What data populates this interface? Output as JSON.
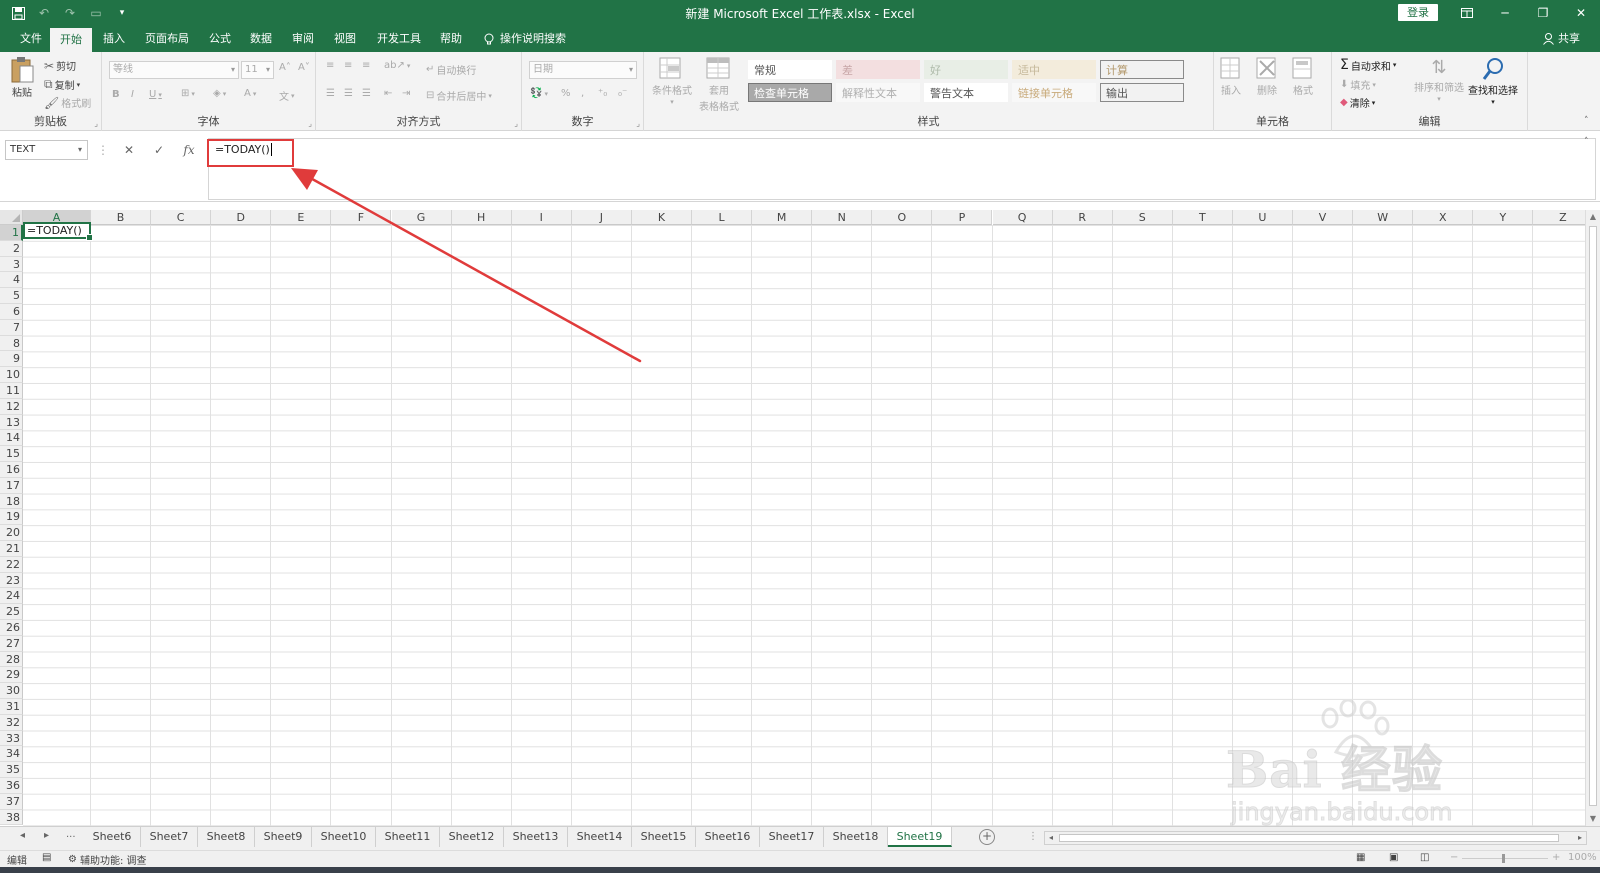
{
  "window": {
    "title": "新建 Microsoft Excel 工作表.xlsx  -  Excel",
    "login_label": "登录",
    "controls": [
      "ribbon-display-icon",
      "minimize-icon",
      "restore-icon",
      "close-icon"
    ]
  },
  "menu": {
    "tabs": [
      {
        "label": "文件"
      },
      {
        "label": "开始",
        "active": true
      },
      {
        "label": "插入"
      },
      {
        "label": "页面布局"
      },
      {
        "label": "公式"
      },
      {
        "label": "数据"
      },
      {
        "label": "审阅"
      },
      {
        "label": "视图"
      },
      {
        "label": "开发工具"
      },
      {
        "label": "帮助"
      }
    ],
    "tell_me": "操作说明搜索",
    "share": "共享"
  },
  "ribbon": {
    "clipboard": {
      "label": "剪贴板",
      "paste": "粘贴",
      "cut": "剪切",
      "copy": "复制",
      "format_painter": "格式刷"
    },
    "font": {
      "label": "字体",
      "font_name": "等线",
      "font_size": "11"
    },
    "alignment": {
      "label": "对齐方式",
      "wrap_text": "自动换行",
      "merge_center": "合并后居中"
    },
    "number": {
      "label": "数字",
      "format": "日期"
    },
    "styles": {
      "label": "样式",
      "conditional_formatting": "条件格式",
      "format_as_table_line1": "套用",
      "format_as_table_line2": "表格格式",
      "cells": [
        {
          "label": "常规",
          "bg": "#ffffff",
          "fg": "#555555"
        },
        {
          "label": "差",
          "bg": "#f3dfe0",
          "fg": "#c8a7a8"
        },
        {
          "label": "好",
          "bg": "#e8eee6",
          "fg": "#aebaa9"
        },
        {
          "label": "适中",
          "bg": "#f3ecdc",
          "fg": "#c6b99b"
        },
        {
          "label": "计算",
          "bg": "#f2f2f2",
          "fg": "#b49a6e"
        },
        {
          "label": "检查单元格",
          "bg": "#a9a9a9",
          "fg": "#ffffff"
        },
        {
          "label": "解释性文本",
          "bg": "#f8f8f8",
          "fg": "#b0b0b0"
        },
        {
          "label": "警告文本",
          "bg": "#ffffff",
          "fg": "#555555"
        },
        {
          "label": "链接单元格",
          "bg": "#f8f8f8",
          "fg": "#c8aa7a"
        },
        {
          "label": "输出",
          "bg": "#f2f2f2",
          "fg": "#555555"
        }
      ]
    },
    "cells": {
      "label": "单元格",
      "insert": "插入",
      "delete": "删除",
      "format": "格式"
    },
    "editing": {
      "label": "编辑",
      "autosum": "自动求和",
      "fill": "填充",
      "clear": "清除",
      "sort_filter": "排序和筛选",
      "find_select": "查找和选择"
    }
  },
  "formula_bar": {
    "name_box": "TEXT",
    "cancel_icon": "close-icon",
    "enter_icon": "check-icon",
    "fx_label": "fx",
    "content": "=TODAY()"
  },
  "grid": {
    "columns": [
      "A",
      "B",
      "C",
      "D",
      "E",
      "F",
      "G",
      "H",
      "I",
      "J",
      "K",
      "L",
      "M",
      "N",
      "O",
      "P",
      "Q",
      "R",
      "S",
      "T",
      "U",
      "V",
      "W",
      "X",
      "Y",
      "Z"
    ],
    "rows": [
      "1",
      "2",
      "3",
      "4",
      "5",
      "6",
      "7",
      "8",
      "9",
      "10",
      "11",
      "12",
      "13",
      "14",
      "15",
      "16",
      "17",
      "18",
      "19",
      "20",
      "21",
      "22",
      "23",
      "24",
      "25",
      "26",
      "27",
      "28",
      "29",
      "30",
      "31",
      "32",
      "33",
      "34",
      "35",
      "36",
      "37",
      "38"
    ],
    "active_cell": "A1",
    "active_cell_content": "=TODAY()"
  },
  "sheets": {
    "overflow": "...",
    "tabs": [
      {
        "label": "Sheet6"
      },
      {
        "label": "Sheet7"
      },
      {
        "label": "Sheet8"
      },
      {
        "label": "Sheet9"
      },
      {
        "label": "Sheet10"
      },
      {
        "label": "Sheet11"
      },
      {
        "label": "Sheet12"
      },
      {
        "label": "Sheet13"
      },
      {
        "label": "Sheet14"
      },
      {
        "label": "Sheet15"
      },
      {
        "label": "Sheet16"
      },
      {
        "label": "Sheet17"
      },
      {
        "label": "Sheet18"
      },
      {
        "label": "Sheet19",
        "active": true
      }
    ]
  },
  "status": {
    "mode": "编辑",
    "accessibility": "辅助功能: 调查",
    "zoom": "100%"
  },
  "annotation": {
    "color": "#e03b3b"
  },
  "watermark": {
    "brand": "Bai 经验",
    "url": "jingyan.baidu.com"
  }
}
